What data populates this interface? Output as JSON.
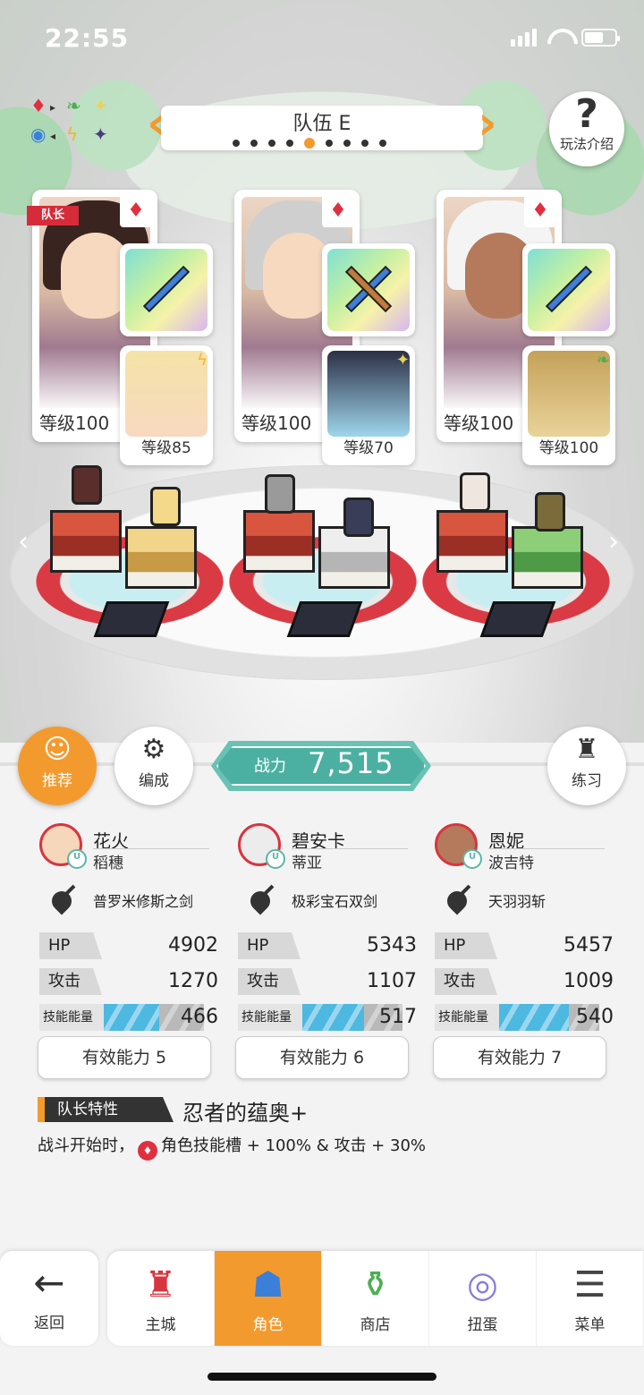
{
  "status_bar": {
    "time": "22:55"
  },
  "team": {
    "title": "队伍 E",
    "page_count": 9,
    "active_page_index": 4
  },
  "help": {
    "label": "玩法介绍"
  },
  "leader_tag": "队长",
  "cards": [
    {
      "level": "等级100",
      "support_level": "等级85",
      "support_element": "lightning"
    },
    {
      "level": "等级100",
      "support_level": "等级70",
      "support_element": "light"
    },
    {
      "level": "等级100",
      "support_level": "等级100",
      "support_element": "wind"
    }
  ],
  "actions": {
    "recommend": "推荐",
    "formation": "编成",
    "practice": "练习"
  },
  "power": {
    "label": "战力",
    "value": "7,515"
  },
  "characters": [
    {
      "name": "花火",
      "sub": "稻穗",
      "weapon": "普罗米修斯之剑",
      "hp_label": "HP",
      "hp": "4902",
      "atk_label": "攻击",
      "atk": "1270",
      "skill_label": "技能能量",
      "skill": "466",
      "skill_fraction": 0.55,
      "effective": "有效能力 5"
    },
    {
      "name": "碧安卡",
      "sub": "蒂亚",
      "weapon": "极彩宝石双剑",
      "hp_label": "HP",
      "hp": "5343",
      "atk_label": "攻击",
      "atk": "1107",
      "skill_label": "技能能量",
      "skill": "517",
      "skill_fraction": 0.62,
      "effective": "有效能力 6"
    },
    {
      "name": "恩妮",
      "sub": "波吉特",
      "weapon": "天羽羽斩",
      "hp_label": "HP",
      "hp": "5457",
      "atk_label": "攻击",
      "atk": "1009",
      "skill_label": "技能能量",
      "skill": "540",
      "skill_fraction": 0.7,
      "effective": "有效能力 7"
    }
  ],
  "leader_trait": {
    "tag": "队长特性",
    "name": "忍者的蕴奥+",
    "desc_prefix": "战斗开始时，",
    "desc_suffix": "角色技能槽 + 100% & 攻击 + 30%"
  },
  "nav": {
    "back": "返回",
    "tabs": [
      "主城",
      "角色",
      "商店",
      "扭蛋",
      "菜单"
    ],
    "active_tab_index": 1
  },
  "colors": {
    "accent": "#f39a2e",
    "teal": "#4bb0a1",
    "element_red": "#e0303f"
  }
}
